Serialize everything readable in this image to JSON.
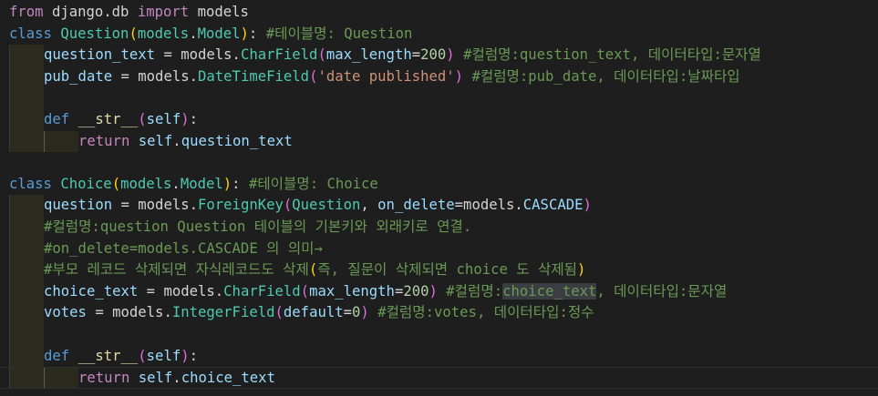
{
  "editor": {
    "theme_colors": {
      "background": "#1e1e1e",
      "keyword": "#569cd6",
      "control": "#c586c0",
      "class": "#4ec9b0",
      "function": "#dcdcaa",
      "variable": "#9cdcfe",
      "number": "#b5cea8",
      "string": "#ce9178",
      "comment": "#6a9955"
    },
    "lines": {
      "l1": {
        "t1": "from",
        "t2": " django.db ",
        "t3": "import",
        "t4": " models"
      },
      "l2": {
        "t1": "class",
        "t2": " ",
        "t3": "Question",
        "t4": "(",
        "t5": "models",
        "t6": ".",
        "t7": "Model",
        "t8": ")",
        "t9": ": ",
        "t10": "#테이블명: Question"
      },
      "l3": {
        "t1": "question_text",
        "t2": " = models.",
        "t3": "CharField",
        "t4": "(",
        "t5": "max_length",
        "t6": "=",
        "t7": "200",
        "t8": ")",
        "t9": " ",
        "t10": "#컬럼명:question_text, 데이터타입:문자열"
      },
      "l4": {
        "t1": "pub_date",
        "t2": " = models.",
        "t3": "DateTimeField",
        "t4": "(",
        "t5": "'date published'",
        "t6": ")",
        "t7": " ",
        "t8": "#컬럼명:pub_date, 데이터타입:날짜타입"
      },
      "l5": {},
      "l6": {
        "t1": "def",
        "t2": " ",
        "t3": "__str__",
        "t4": "(",
        "t5": "self",
        "t6": ")",
        "t7": ":"
      },
      "l7": {
        "t1": "return",
        "t2": " ",
        "t3": "self",
        "t4": ".",
        "t5": "question_text"
      },
      "l8": {},
      "l9": {
        "t1": "class",
        "t2": " ",
        "t3": "Choice",
        "t4": "(",
        "t5": "models",
        "t6": ".",
        "t7": "Model",
        "t8": ")",
        "t9": ": ",
        "t10": "#테이블명: Choice"
      },
      "l10": {
        "t1": "question",
        "t2": " = models.",
        "t3": "ForeignKey",
        "t4": "(",
        "t5": "Question",
        "t6": ", ",
        "t7": "on_delete",
        "t8": "=models.",
        "t9": "CASCADE",
        "t10": ")"
      },
      "l11": {
        "t1": "#컬럼명:question Question 테이블의 기본키와 외래키로 연결."
      },
      "l12": {
        "t1": "#on_delete=models.CASCADE 의 의미→"
      },
      "l13": {
        "t1": "#부모 레코드 삭제되면 자식레코드도 삭제",
        "t2": "(",
        "t3": "즉, 질문이 삭제되면 choice 도 삭제됨",
        "t4": ")"
      },
      "l14": {
        "t1": "choice_text",
        "t2": " = models.",
        "t3": "CharField",
        "t4": "(",
        "t5": "max_length",
        "t6": "=",
        "t7": "200",
        "t8": ")",
        "t9": " ",
        "t10": "#컬럼명:",
        "t11": "choice_text",
        "t12": ", 데이터타입:문자열"
      },
      "l15": {
        "t1": "votes",
        "t2": " = models.",
        "t3": "IntegerField",
        "t4": "(",
        "t5": "default",
        "t6": "=",
        "t7": "0",
        "t8": ")",
        "t9": " ",
        "t10": "#컬럼명:votes, 데이터타입:정수"
      },
      "l16": {},
      "l17": {
        "t1": "def",
        "t2": " ",
        "t3": "__str__",
        "t4": "(",
        "t5": "self",
        "t6": ")",
        "t7": ":"
      },
      "l18": {
        "t1": "return",
        "t2": " ",
        "t3": "self",
        "t4": ".",
        "t5": "choice_text"
      }
    }
  }
}
